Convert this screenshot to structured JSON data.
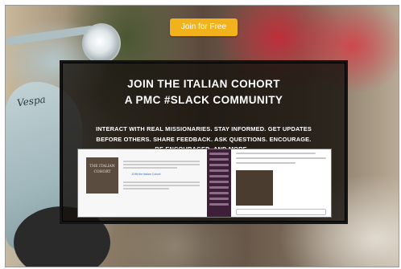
{
  "background": {
    "brand_text": "Vespa"
  },
  "cta": {
    "label": "Join for Free",
    "color": "#f1b21c"
  },
  "promo": {
    "title_line1": "JOIN THE ITALIAN COHORT",
    "title_line2": "A PMC #SLACK COMMUNITY",
    "description": "INTERACT WITH REAL MISSIONARIES. STAY INFORMED. GET UPDATES BEFORE OTHERS. SHARE FEEDBACK. ASK QUESTIONS. ENCOURAGE. BE ENCOURAGED. AND MORE..."
  },
  "preview": {
    "book_cover_text": "THE ITALIAN COHORT",
    "link_text": "JOIN the Italian Cohort"
  }
}
